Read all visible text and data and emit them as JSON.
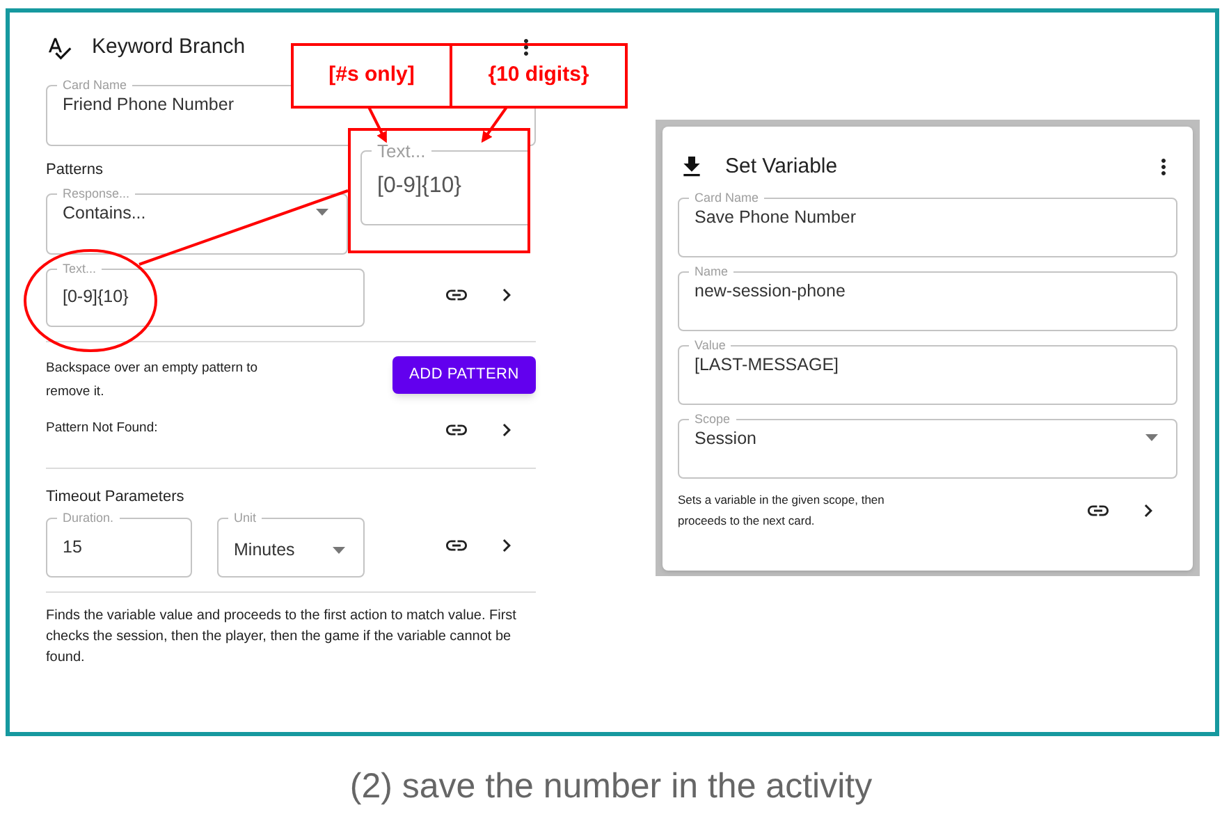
{
  "keyword_branch_card": {
    "title": "Keyword Branch",
    "card_name": {
      "label": "Card Name",
      "value": "Friend Phone Number"
    },
    "patterns_heading": "Patterns",
    "response": {
      "label": "Response...",
      "value": "Contains..."
    },
    "pattern_text": {
      "label": "Text...",
      "value": "[0-9]{10}"
    },
    "pattern_hint": "Backspace over an empty pattern to remove it.",
    "add_pattern_button": "ADD PATTERN",
    "pattern_not_found": "Pattern Not Found:",
    "timeout_heading": "Timeout Parameters",
    "duration": {
      "label": "Duration.",
      "value": "15"
    },
    "unit": {
      "label": "Unit",
      "value": "Minutes"
    },
    "description": "Finds the variable value and proceeds to the first action to match value. First checks the session, then the player, then the game if the variable cannot be found."
  },
  "set_variable_card": {
    "title": "Set Variable",
    "fields": [
      {
        "kind": "text",
        "label": "Card Name",
        "value": "Save Phone Number"
      },
      {
        "kind": "text",
        "label": "Name",
        "value": "new-session-phone"
      },
      {
        "kind": "text",
        "label": "Value",
        "value": "[LAST-MESSAGE]"
      },
      {
        "kind": "select",
        "label": "Scope",
        "value": "Session"
      }
    ],
    "description": "Sets a variable in the given scope, then proceeds to the next card."
  },
  "annotations": {
    "callout": {
      "label": "Text...",
      "value": "[0-9]{10}"
    },
    "notes": [
      "[#s only]",
      "{10 digits}"
    ]
  },
  "caption": "(2) save the number in the activity"
}
